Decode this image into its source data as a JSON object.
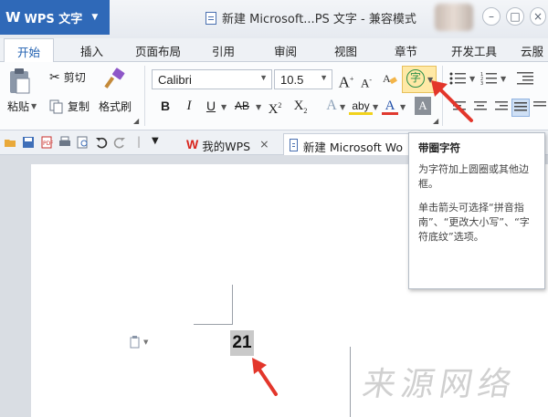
{
  "app": {
    "name": "WPS 文字",
    "logo": "W"
  },
  "document_title": "新建 Microsoft...PS 文字 - 兼容模式",
  "ribbon_tabs": [
    {
      "label": "开始",
      "active": true
    },
    {
      "label": "插入"
    },
    {
      "label": "页面布局"
    },
    {
      "label": "引用"
    },
    {
      "label": "审阅"
    },
    {
      "label": "视图"
    },
    {
      "label": "章节"
    },
    {
      "label": "开发工具"
    },
    {
      "label": "云服"
    }
  ],
  "clipboard": {
    "paste": "粘贴",
    "cut": "剪切",
    "copy": "复制",
    "format_painter": "格式刷"
  },
  "font": {
    "family": "Calibri",
    "size": "10.5",
    "grow": "A",
    "shrink": "A",
    "bold": "B",
    "italic": "I",
    "underline": "U",
    "strike": "AB",
    "superscript": "X",
    "subscript": "X",
    "text_effect": "A",
    "highlight": "aby",
    "font_color": "A",
    "shading": "A",
    "enclose_char": "字"
  },
  "quickbar": {
    "tabs": [
      {
        "label": "我的WPS"
      },
      {
        "label": "新建 Microsoft Wo",
        "active": true
      }
    ]
  },
  "tooltip": {
    "title": "带圈字符",
    "desc1": "为字符加上圆圈或其他边框。",
    "desc2": "单击箭头可选择“拼音指南”、“更改大小写”、“字符底纹”选项。"
  },
  "document": {
    "selected_text": "21"
  },
  "watermark": "来源网络",
  "colors": {
    "accent": "#2f69b8",
    "arrow": "#e3362b",
    "wps_red": "#d9251d"
  }
}
